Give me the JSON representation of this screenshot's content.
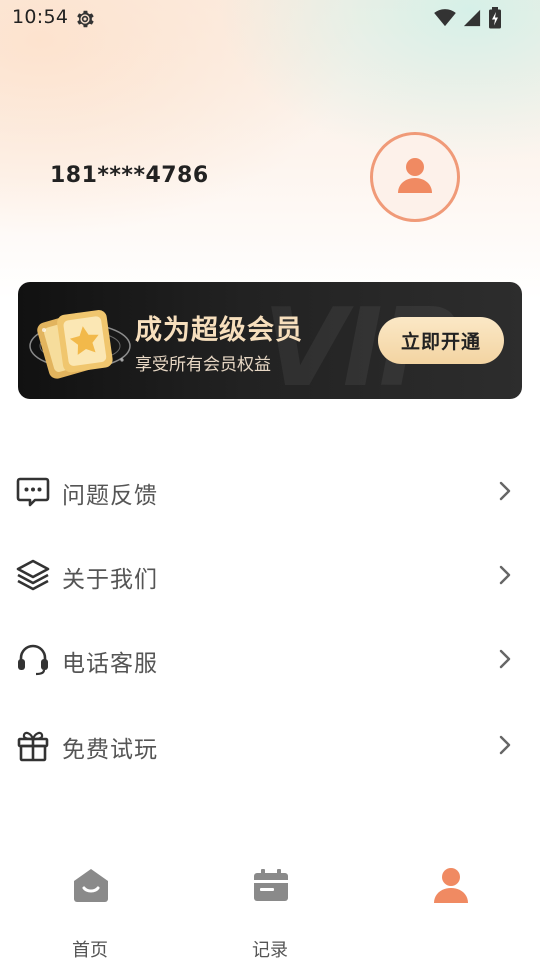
{
  "status_bar": {
    "time": "10:54"
  },
  "profile": {
    "phone": "181****4786"
  },
  "vip_card": {
    "title": "成为超级会员",
    "subtitle": "享受所有会员权益",
    "watermark": "VIP",
    "button_label": "立即开通"
  },
  "menu": {
    "items": [
      {
        "label": "问题反馈",
        "icon": "feedback-message-icon"
      },
      {
        "label": "关于我们",
        "icon": "layers-icon"
      },
      {
        "label": "电话客服",
        "icon": "headset-icon"
      },
      {
        "label": "免费试玩",
        "icon": "gift-icon"
      }
    ]
  },
  "tabbar": {
    "tabs": [
      {
        "label": "首页",
        "icon": "home-icon",
        "active": false
      },
      {
        "label": "记录",
        "icon": "calendar-icon",
        "active": false
      },
      {
        "label": "",
        "icon": "user-icon",
        "active": true
      }
    ]
  },
  "colors": {
    "accent": "#f08a62",
    "avatar_border": "#f09a78",
    "vip_gold": "#f7dfbd",
    "text_dark": "#222222",
    "text_muted": "#555555",
    "icon_gray": "#8a8a8a"
  }
}
